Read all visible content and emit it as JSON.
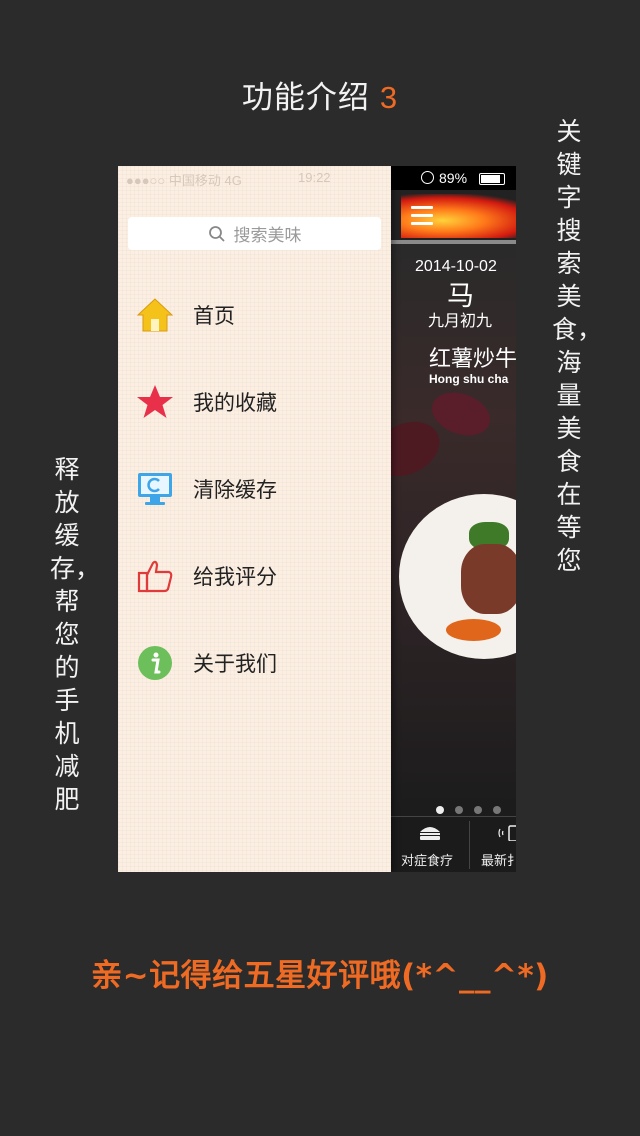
{
  "headline": {
    "text": "功能介绍",
    "number": "3"
  },
  "right_caption": "关键字搜索美食，海量美食在等您",
  "left_caption": "释放缓存，帮您的手机减肥",
  "drawer": {
    "status": {
      "carrier": "●●●○○ 中国移动  4G",
      "time": "19:22"
    },
    "search_placeholder": "搜索美味",
    "items": [
      {
        "label": "首页",
        "icon": "home-icon"
      },
      {
        "label": "我的收藏",
        "icon": "star-icon"
      },
      {
        "label": "清除缓存",
        "icon": "monitor-icon"
      },
      {
        "label": "给我评分",
        "icon": "thumbs-up-icon"
      },
      {
        "label": "关于我们",
        "icon": "info-icon"
      }
    ]
  },
  "main": {
    "battery": "89%",
    "date": "2014-10-02",
    "zodiac": "马",
    "lunar_date": "九月初九",
    "dish_name": "红薯炒牛",
    "dish_pinyin": "Hong shu cha",
    "tabs": [
      {
        "label": "对症食疗",
        "icon": "burger-icon"
      },
      {
        "label": "最新扌",
        "icon": "phone-icon"
      }
    ]
  },
  "footer": "亲~记得给五星好评哦(*^__^*)",
  "colors": {
    "accent": "#ef6a23",
    "background": "#2b2b2b",
    "drawer": "#fcefe2"
  }
}
